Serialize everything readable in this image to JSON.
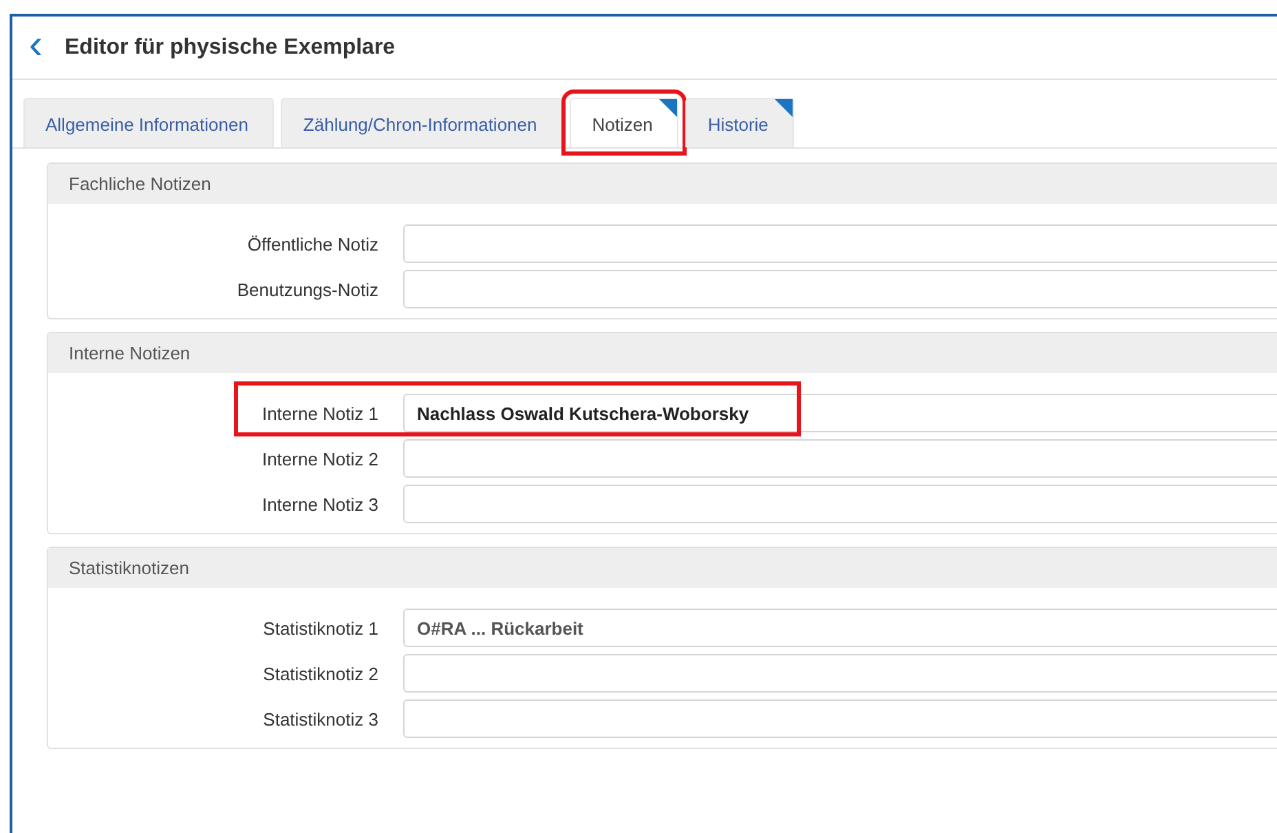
{
  "header": {
    "back_icon": "‹",
    "title": "Editor für physische Exemplare"
  },
  "tabs": [
    {
      "label": "Allgemeine Informationen",
      "selected": false,
      "has_notes": false,
      "highlighted": false
    },
    {
      "label": "Zählung/Chron-Informationen",
      "selected": false,
      "has_notes": false,
      "highlighted": false
    },
    {
      "label": "Notizen",
      "selected": true,
      "has_notes": true,
      "highlighted": true
    },
    {
      "label": "Historie",
      "selected": false,
      "has_notes": true,
      "highlighted": false
    }
  ],
  "sections": [
    {
      "title": "Fachliche Notizen",
      "fields": [
        {
          "label": "Öffentliche Notiz",
          "highlighted": false
        },
        {
          "label": "Benutzungs-Notiz",
          "highlighted": false
        }
      ]
    },
    {
      "title": "Interne Notizen",
      "fields": [
        {
          "label": "Interne Notiz 1",
          "value": "Nachlass Oswald Kutschera-Woborsky",
          "highlighted": true
        },
        {
          "label": "Interne Notiz 2",
          "highlighted": false
        },
        {
          "label": "Interne Notiz 3",
          "highlighted": false
        }
      ]
    },
    {
      "title": "Statistiknotizen",
      "fields": [
        {
          "label": "Statistiknotiz 1",
          "value": "O#RA ... Rückarbeit",
          "highlighted": false
        },
        {
          "label": "Statistiknotiz 2",
          "highlighted": false
        },
        {
          "label": "Statistiknotiz 3",
          "highlighted": false
        }
      ]
    }
  ]
}
